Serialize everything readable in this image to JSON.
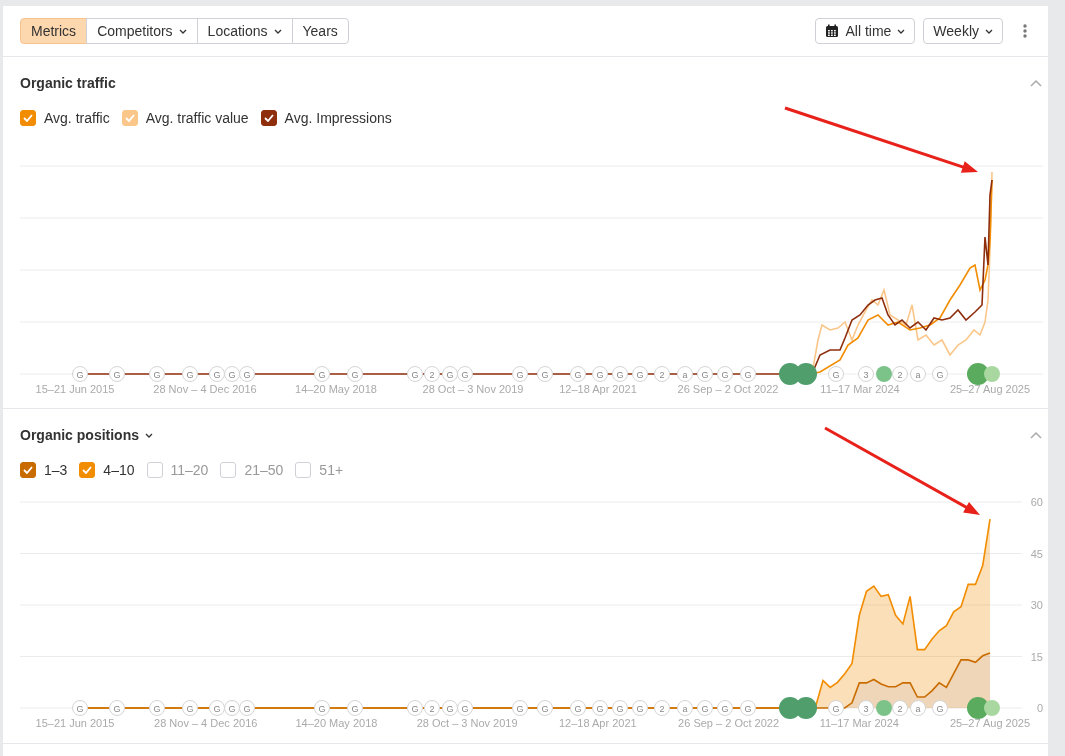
{
  "toolbar": {
    "segments": [
      {
        "label": "Metrics",
        "selected": true,
        "kind": "plain"
      },
      {
        "label": "Competitors",
        "selected": false,
        "kind": "dropdown"
      },
      {
        "label": "Locations",
        "selected": false,
        "kind": "dropdown"
      },
      {
        "label": "Years",
        "selected": false,
        "kind": "plain"
      }
    ],
    "date_range": {
      "label": "All time"
    },
    "interval": {
      "label": "Weekly"
    }
  },
  "organic_traffic": {
    "title": "Organic traffic",
    "expanded": true,
    "legend": [
      {
        "label": "Avg. traffic",
        "checked": true,
        "color": "#f28c00"
      },
      {
        "label": "Avg. traffic value",
        "checked": true,
        "color": "#fbc689"
      },
      {
        "label": "Avg. Impressions",
        "checked": true,
        "color": "#8e2e0c"
      }
    ],
    "x_labels": [
      "15–21 Jun 2015",
      "28 Nov – 4 Dec 2016",
      "14–20 May 2018",
      "28 Oct – 3 Nov 2019",
      "12–18 Apr 2021",
      "26 Sep – 2 Oct 2022",
      "11–17 Mar 2024",
      "25–27 Aug 2025"
    ],
    "markers": [
      {
        "kind": "plain",
        "label": "G"
      },
      {
        "kind": "plain",
        "label": "G"
      },
      {
        "kind": "plain",
        "label": "G"
      },
      {
        "kind": "plain",
        "label": "G"
      },
      {
        "kind": "plain",
        "label": "G"
      },
      {
        "kind": "plain",
        "label": "G"
      },
      {
        "kind": "plain",
        "label": "G"
      },
      {
        "kind": "plain",
        "label": "G"
      },
      {
        "kind": "plain",
        "label": "G"
      },
      {
        "kind": "plain",
        "label": "G"
      },
      {
        "kind": "plain",
        "label": "2"
      },
      {
        "kind": "plain",
        "label": "G"
      },
      {
        "kind": "plain",
        "label": "G"
      },
      {
        "kind": "plain",
        "label": "G"
      },
      {
        "kind": "plain",
        "label": "G"
      },
      {
        "kind": "plain",
        "label": "G"
      },
      {
        "kind": "plain",
        "label": "G"
      },
      {
        "kind": "plain",
        "label": "G"
      },
      {
        "kind": "plain",
        "label": "G"
      },
      {
        "kind": "plain",
        "label": "2"
      },
      {
        "kind": "plain",
        "label": "a"
      },
      {
        "kind": "plain",
        "label": "G"
      },
      {
        "kind": "plain",
        "label": "G"
      },
      {
        "kind": "plain",
        "label": "G"
      },
      {
        "kind": "green",
        "color": "#4f9e6c"
      },
      {
        "kind": "green",
        "color": "#4f9e6c"
      },
      {
        "kind": "plain",
        "label": "G"
      },
      {
        "kind": "plain",
        "label": "3"
      },
      {
        "kind": "green",
        "color": "#7cc38a"
      },
      {
        "kind": "plain",
        "label": "2"
      },
      {
        "kind": "plain",
        "label": "a"
      },
      {
        "kind": "plain",
        "label": "G"
      },
      {
        "kind": "green",
        "color": "#5aab5e"
      },
      {
        "kind": "green",
        "color": "#a8d8a0"
      }
    ]
  },
  "organic_positions": {
    "title": "Organic positions",
    "expanded": true,
    "legend": [
      {
        "checked": true
      },
      {
        "checked": true
      },
      {
        "label": "11–20",
        "checked": false
      },
      {
        "label": "21–50",
        "checked": false
      },
      {
        "label": "51+",
        "checked": false
      }
    ],
    "markers": [
      {
        "kind": "plain",
        "label": "G"
      },
      {
        "kind": "plain",
        "label": "G"
      },
      {
        "kind": "plain",
        "label": "G"
      },
      {
        "kind": "plain",
        "label": "G"
      },
      {
        "kind": "plain",
        "label": "G"
      },
      {
        "kind": "plain",
        "label": "G"
      },
      {
        "kind": "plain",
        "label": "G"
      },
      {
        "kind": "plain",
        "label": "G"
      },
      {
        "kind": "plain",
        "label": "G"
      },
      {
        "kind": "plain",
        "label": "G"
      },
      {
        "kind": "plain",
        "label": "2"
      },
      {
        "kind": "plain",
        "label": "G"
      },
      {
        "kind": "plain",
        "label": "G"
      },
      {
        "kind": "plain",
        "label": "G"
      },
      {
        "kind": "plain",
        "label": "G"
      },
      {
        "kind": "plain",
        "label": "G"
      },
      {
        "kind": "plain",
        "label": "G"
      },
      {
        "kind": "plain",
        "label": "G"
      },
      {
        "kind": "plain",
        "label": "G"
      },
      {
        "kind": "plain",
        "label": "2"
      },
      {
        "kind": "plain",
        "label": "a"
      },
      {
        "kind": "plain",
        "label": "G"
      },
      {
        "kind": "plain",
        "label": "G"
      },
      {
        "kind": "plain",
        "label": "G"
      },
      {
        "kind": "green",
        "color": "#4f9e6c"
      },
      {
        "kind": "green",
        "color": "#4f9e6c"
      },
      {
        "kind": "plain",
        "label": "G"
      },
      {
        "kind": "plain",
        "label": "3"
      },
      {
        "kind": "green",
        "color": "#7cc38a"
      },
      {
        "kind": "plain",
        "label": "2"
      },
      {
        "kind": "plain",
        "label": "a"
      },
      {
        "kind": "plain",
        "label": "G"
      },
      {
        "kind": "green",
        "color": "#5aab5e"
      },
      {
        "kind": "green",
        "color": "#a8d8a0"
      }
    ],
    "chart_data": {
      "type": "area",
      "stacked": true,
      "grid": true,
      "categories": [
        "15–21 Jun 2015",
        null,
        null,
        null,
        null,
        null,
        null,
        null,
        null,
        null,
        null,
        null,
        null,
        null,
        null,
        null,
        null,
        null,
        "28 Nov – 4 Dec 2016",
        null,
        null,
        null,
        null,
        null,
        null,
        null,
        null,
        null,
        null,
        null,
        null,
        null,
        null,
        null,
        null,
        null,
        "14–20 May 2018",
        null,
        null,
        null,
        null,
        null,
        null,
        null,
        null,
        null,
        null,
        null,
        null,
        null,
        null,
        null,
        null,
        null,
        "28 Oct – 3 Nov 2019",
        null,
        null,
        null,
        null,
        null,
        null,
        null,
        null,
        null,
        null,
        null,
        null,
        null,
        null,
        null,
        null,
        null,
        "12–18 Apr 2021",
        null,
        null,
        null,
        null,
        null,
        null,
        null,
        null,
        null,
        null,
        null,
        null,
        null,
        null,
        null,
        null,
        null,
        "26 Sep – 2 Oct 2022",
        null,
        null,
        null,
        null,
        null,
        null,
        null,
        null,
        null,
        null,
        null,
        null,
        null,
        null,
        null,
        null,
        null,
        "11–17 Mar 2024",
        null,
        null,
        null,
        null,
        null,
        null,
        null,
        null,
        null,
        null,
        null,
        null,
        null,
        null,
        null,
        null,
        null,
        "25–27 Aug 2025"
      ],
      "series": [
        {
          "name": "1–3",
          "color": "#c96c00",
          "values": [
            0,
            0,
            0,
            0,
            0,
            0,
            0,
            0,
            0,
            0,
            0,
            0,
            0,
            0,
            0,
            0,
            0,
            0,
            0,
            0,
            0,
            0,
            0,
            0,
            0,
            0,
            0,
            0,
            0,
            0,
            0,
            0,
            0,
            0,
            0,
            0,
            0,
            0,
            0,
            0,
            0,
            0,
            0,
            0,
            0,
            0,
            0,
            0,
            0,
            0,
            0,
            0,
            0,
            0,
            0,
            0,
            0,
            0,
            0,
            0,
            0,
            0,
            0,
            0,
            0,
            0,
            0,
            0,
            0,
            0,
            0,
            0,
            0,
            0,
            0,
            0,
            0,
            0,
            0,
            0,
            0,
            0,
            0,
            0,
            0,
            0,
            0,
            0,
            0,
            0,
            0,
            0,
            0,
            0,
            0,
            0,
            0,
            0,
            0,
            0,
            0,
            0,
            0,
            0,
            0,
            0,
            0,
            1.5,
            7.3,
            7.3,
            8.3,
            7,
            6.2,
            6.2,
            7.3,
            7.3,
            3.2,
            3.2,
            5,
            7.3,
            6,
            10,
            14,
            14,
            13.3,
            15.2,
            16
          ]
        },
        {
          "name": "4–10",
          "color": "#f28c00",
          "values": [
            0,
            0,
            0,
            0,
            0,
            0,
            0,
            0,
            0,
            0,
            0,
            0,
            0,
            0,
            0,
            0,
            0,
            0,
            0,
            0,
            0,
            0,
            0,
            0,
            0,
            0,
            0,
            0,
            0,
            0,
            0,
            0,
            0,
            0,
            0,
            0,
            0,
            0,
            0,
            0,
            0,
            0,
            0,
            0,
            0,
            0,
            0,
            0,
            0,
            0,
            0,
            0,
            0,
            0,
            0,
            0,
            0,
            0,
            0,
            0,
            0,
            0,
            0,
            0,
            0,
            0,
            0,
            0,
            0,
            0,
            0,
            0,
            0,
            0,
            0,
            0,
            0,
            0,
            0,
            0,
            0,
            0,
            0,
            0,
            0,
            0,
            0,
            0,
            0,
            0,
            0,
            0,
            0,
            0,
            0,
            0,
            0,
            0,
            0,
            0,
            0,
            0,
            0.5,
            8,
            6,
            7.5,
            10,
            11.5,
            19.7,
            26.7,
            27.2,
            25.5,
            26.8,
            20.8,
            17.2,
            25.2,
            13.8,
            13.8,
            15,
            15.2,
            18,
            18,
            15.5,
            22,
            22.7,
            26.3,
            39
          ]
        }
      ],
      "ylim": [
        0,
        60
      ],
      "yticks": [
        {
          "value": 0,
          "label": "0"
        },
        {
          "value": 15,
          "label": "15"
        },
        {
          "value": 30,
          "label": "30"
        },
        {
          "value": 45,
          "label": "45"
        },
        {
          "value": 60,
          "label": "60"
        }
      ]
    }
  }
}
